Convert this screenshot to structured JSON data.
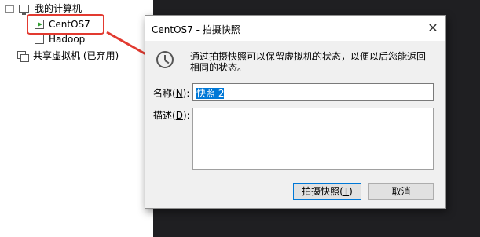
{
  "tree": {
    "root_label": "我的计算机",
    "items": [
      {
        "label": "CentOS7",
        "state": "running"
      },
      {
        "label": "Hadoop",
        "state": "off"
      }
    ],
    "shared_label": "共享虚拟机 (已弃用)"
  },
  "dialog": {
    "title": "CentOS7 - 拍摄快照",
    "description_line1": "通过拍摄快照可以保留虚拟机的状态，以便以后您能返回",
    "description_line2": "相同的状态。",
    "name_label_pre": "名称(",
    "name_label_key": "N",
    "name_label_post": "):",
    "name_value": "快照 2",
    "desc_label_pre": "描述(",
    "desc_label_key": "D",
    "desc_label_post": "):",
    "desc_value": "",
    "snapshot_button_pre": "拍摄快照(",
    "snapshot_button_key": "T",
    "snapshot_button_post": ")",
    "cancel_button": "取消",
    "close_glyph": "✕"
  },
  "icons": {
    "root": "computer-icon",
    "vm_running": "vm-running-icon",
    "vm_off": "vm-icon",
    "shared": "shared-vm-icon",
    "dialog": "clock-icon"
  },
  "colors": {
    "highlight": "#e23a30",
    "arrow": "#e23a30",
    "selection": "#0078d7",
    "workspace": "#1f1f22"
  }
}
